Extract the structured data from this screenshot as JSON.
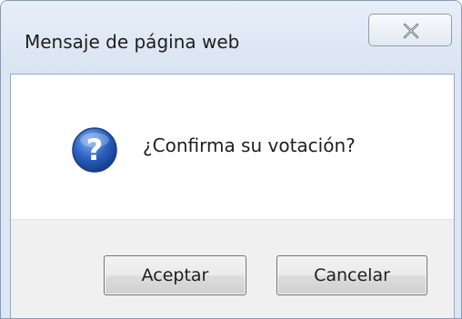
{
  "dialog": {
    "title": "Mensaje de página web",
    "close_icon": "close-icon",
    "message_icon": "question-icon",
    "message": "¿Confirma su votación?",
    "buttons": {
      "accept_label": "Aceptar",
      "cancel_label": "Cancelar"
    }
  },
  "colors": {
    "titlebar": "#dce6f4",
    "icon_blue": "#2b62c3",
    "button_area": "#f0f0f0"
  }
}
